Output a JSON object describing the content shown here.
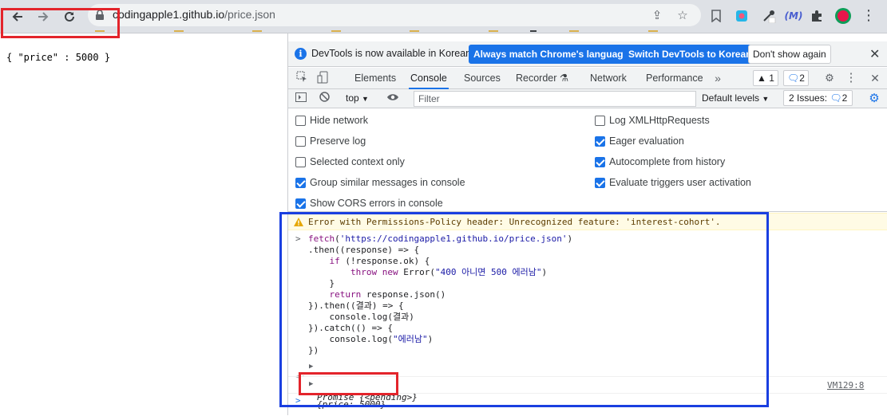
{
  "browser": {
    "url_host": "codingapple1.github.io",
    "url_path": "/price.json"
  },
  "page": {
    "json_text": "{ \"price\" : 5000 }"
  },
  "devtools": {
    "infobar": {
      "message": "DevTools is now available in Korean!",
      "buttons": [
        "Always match Chrome's language",
        "Switch DevTools to Korean",
        "Don't show again"
      ]
    },
    "tabs": [
      "Elements",
      "Console",
      "Sources",
      "Recorder",
      "Network",
      "Performance"
    ],
    "active_tab": "Console",
    "warning_count": "1",
    "issue_count": "2",
    "toolbar": {
      "context": "top",
      "filter_placeholder": "Filter",
      "levels": "Default levels",
      "issues_label": "2 Issues:",
      "issues_count": "2"
    },
    "settings_left": [
      {
        "label": "Hide network",
        "checked": false
      },
      {
        "label": "Preserve log",
        "checked": false
      },
      {
        "label": "Selected context only",
        "checked": false
      },
      {
        "label": "Group similar messages in console",
        "checked": true
      },
      {
        "label": "Show CORS errors in console",
        "checked": true
      }
    ],
    "settings_right": [
      {
        "label": "Log XMLHttpRequests",
        "checked": false
      },
      {
        "label": "Eager evaluation",
        "checked": true
      },
      {
        "label": "Autocomplete from history",
        "checked": true
      },
      {
        "label": "Evaluate triggers user activation",
        "checked": true
      }
    ],
    "console": {
      "warning": "Error with Permissions-Policy header: Unrecognized feature: 'interest-cohort'.",
      "code_lines": [
        "fetch('https://codingapple1.github.io/price.json')",
        ".then((response) => {",
        "    if (!response.ok) {",
        "        throw new Error(\"400 아니면 500 에러남\")",
        "    }",
        "    return response.json()",
        "}).then((결과) => {",
        "    console.log(결과)",
        "}).catch(() => {",
        "    console.log(\"에러남\")",
        "})"
      ],
      "promise_result": "Promise {<pending>}",
      "log_result": "{price: 5000}",
      "source_link": "VM129:8"
    }
  }
}
